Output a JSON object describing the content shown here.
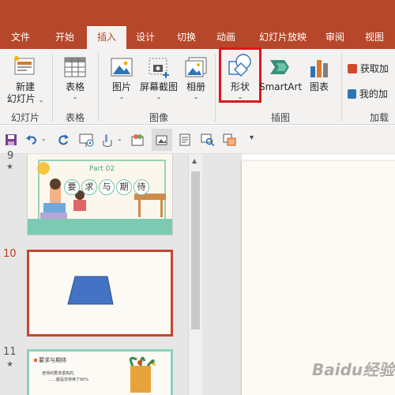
{
  "tabs": [
    {
      "label": "文件"
    },
    {
      "label": "开始"
    },
    {
      "label": "插入"
    },
    {
      "label": "设计"
    },
    {
      "label": "切换"
    },
    {
      "label": "动画"
    },
    {
      "label": "幻灯片放映"
    },
    {
      "label": "审阅"
    },
    {
      "label": "视图"
    }
  ],
  "active_tab": "插入",
  "ribbon": {
    "new_slide": {
      "line1": "新建",
      "line2": "幻灯片"
    },
    "table": {
      "label": "表格"
    },
    "picture": {
      "label": "图片"
    },
    "screenshot": {
      "label": "屏幕截图"
    },
    "album": {
      "label": "相册"
    },
    "shapes": {
      "label": "形状"
    },
    "smartart": {
      "label": "SmartArt"
    },
    "chart": {
      "label": "图表"
    },
    "get_addins": {
      "label": "获取加"
    },
    "my_addins": {
      "label": "我的加"
    },
    "groups": {
      "slides": "幻灯片",
      "tables": "表格",
      "images": "图像",
      "illustrations": "插图",
      "addins": "加载"
    }
  },
  "quick_access": {
    "icons": [
      "save-icon",
      "undo-icon",
      "redo-icon",
      "slideshow-icon",
      "touch-icon",
      "insert-picture-icon",
      "screenshot-icon",
      "print-preview-icon",
      "find-icon",
      "format-icon",
      "more-icon"
    ]
  },
  "slides": [
    {
      "number": "9",
      "starred": true,
      "part": "Part 02",
      "title_chars": [
        "要",
        "求",
        "与",
        "期",
        "待"
      ]
    },
    {
      "number": "10",
      "current": true,
      "shape": "trapezoid",
      "shape_color": "#4472c4"
    },
    {
      "number": "11",
      "starred": true,
      "heading": "要求与期待",
      "line1": "老师的要求很高的,",
      "line2": "……都是非常棒了90%"
    }
  ],
  "watermark": "Baidu经验",
  "colors": {
    "brand": "#b7472a",
    "highlight": "#e0161b",
    "selected_slide": "#c2492c"
  }
}
